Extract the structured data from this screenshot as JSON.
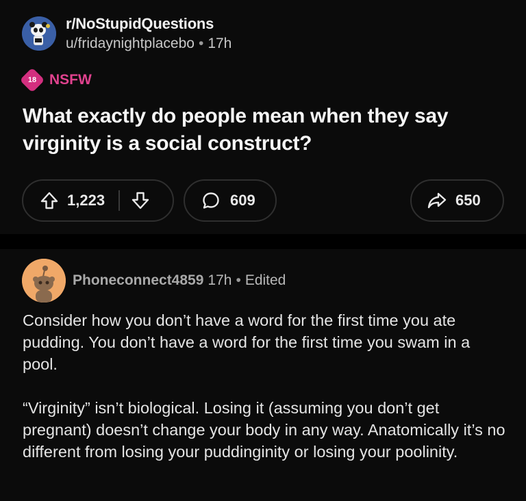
{
  "post": {
    "subreddit": "r/NoStupidQuestions",
    "author": "u/fridaynightplacebo",
    "separator": "•",
    "age": "17h",
    "nsfw_badge": "18",
    "nsfw_label": "NSFW",
    "title": "What exactly do people mean when they say virginity is a social construct?",
    "upvotes": "1,223",
    "comments": "609",
    "shares": "650"
  },
  "comment": {
    "author": "Phoneconnect4859",
    "age": "17h",
    "separator": "•",
    "edited": "Edited",
    "paragraphs": [
      "Consider how you don’t have a word for the first time you ate pudding. You don’t have a word for the first time you swam in a pool.",
      "“Virginity” isn’t biological. Losing it (assuming you don’t get pregnant) doesn’t change your body in any way. Anatomically it’s no different from losing your puddinginity or losing your poolinity."
    ]
  },
  "icons": {
    "upvote": "arrow-up-icon",
    "downvote": "arrow-down-icon",
    "comment": "speech-bubble-icon",
    "share": "share-arrow-icon"
  },
  "colors": {
    "background": "#0b0b0b",
    "nsfw": "#e0428e",
    "subreddit_avatar": "#3a5fa6",
    "user_avatar": "#f0a868"
  }
}
